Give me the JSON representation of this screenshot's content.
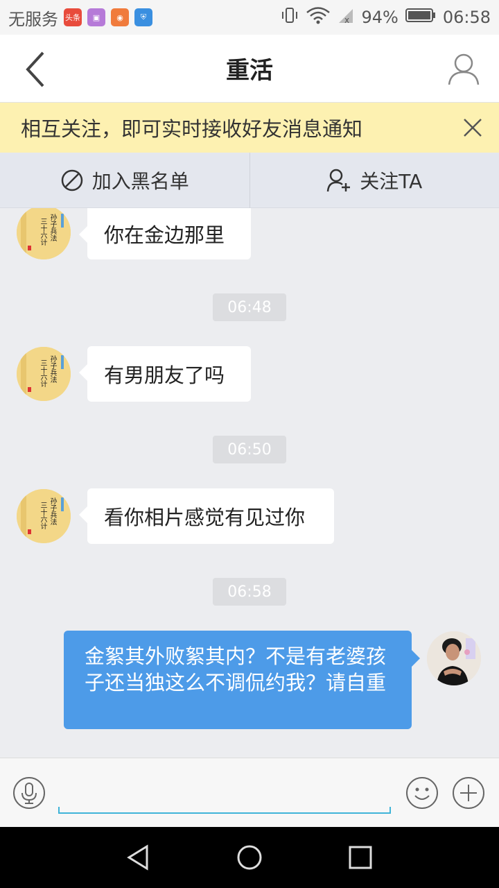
{
  "status_bar": {
    "carrier": "无服务",
    "app_badge": "头条",
    "battery": "94%",
    "time": "06:58"
  },
  "header": {
    "title": "重活"
  },
  "banner": {
    "text": "相互关注，即可实时接收好友消息通知"
  },
  "actions": {
    "blacklist_label": "加入黑名单",
    "follow_label": "关注TA"
  },
  "avatar_book": {
    "line1": "孙子兵法",
    "line2": "三十六计"
  },
  "messages": [
    {
      "type": "in",
      "text": "你在金边那里"
    },
    {
      "type": "time",
      "text": "06:48"
    },
    {
      "type": "in",
      "text": "有男朋友了吗"
    },
    {
      "type": "time",
      "text": "06:50"
    },
    {
      "type": "in",
      "text": "看你相片感觉有见过你"
    },
    {
      "type": "time",
      "text": "06:58"
    },
    {
      "type": "out",
      "text": "金絮其外败絮其内？不是有老婆孩子还当独这么不调侃约我？请自重"
    }
  ],
  "colors": {
    "accent_blue": "#4d9be8",
    "banner_yellow": "#fdf1b1",
    "input_underline": "#3fb4d8"
  }
}
